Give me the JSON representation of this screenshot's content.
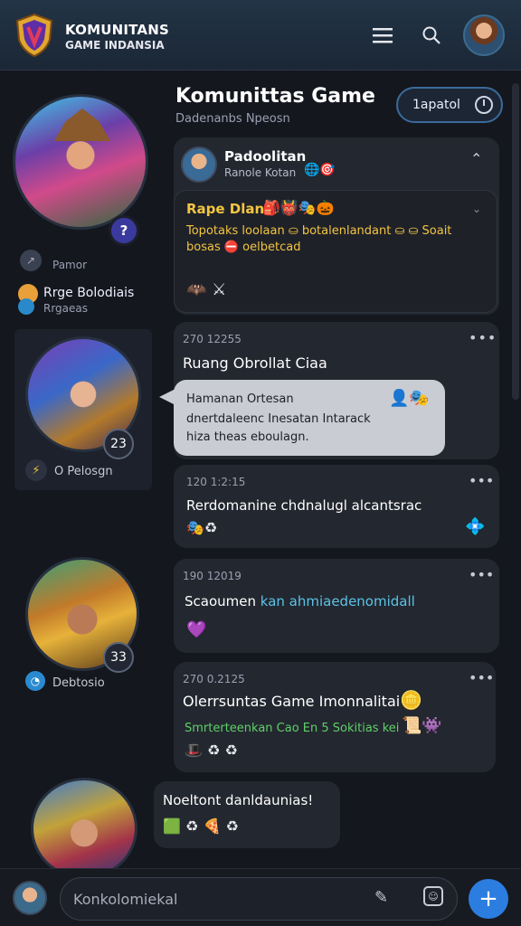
{
  "header": {
    "brand_line1": "KOMUNITANS",
    "brand_line2": "GAME INDANSIA"
  },
  "left": {
    "profile1": {
      "badge": "?",
      "meta": "Pamor",
      "name": "Rrge Bolodiais",
      "status": "Rrgaeas"
    },
    "profile2": {
      "badge": "23",
      "label": "O Pelosgn"
    },
    "profile3": {
      "badge": "33",
      "label": "Debtosio"
    }
  },
  "main": {
    "title": "Komunittas Game",
    "subtitle": "Dadenanbs Npeosn",
    "filter_label": "1apatol",
    "top_card": {
      "name": "Padoolitan",
      "sub": "Ranole Kotan",
      "label": "Rape Dlan",
      "text1": "Topotaks loolaan ⛀ botalenlandant ⛀ ⛀ Soait",
      "text2": "bosas ⛔ oelbetcad"
    },
    "posts": [
      {
        "time": "270 12255",
        "title": "Ruang Obrollat Ciaa",
        "bubble1": "Hamanan Ortesan",
        "bubble2": "dnertdaleenc Inesatan Intarack",
        "bubble3": "hiza  theas eboulagn."
      },
      {
        "time": "120 1:2:15",
        "title": "Rerdomanine chdnalugl alcantsrac"
      },
      {
        "time": "190 12019",
        "title_a": "Scaoumen ",
        "title_b": "kan ahmiaedenomidall"
      },
      {
        "time": "270 0.2125",
        "title": "Olerrsuntas Game Imonnalitai",
        "sub": "Smrterteenkan Cao En 5 Sokitias kei"
      },
      {
        "title": "Noeltont danldaunias!"
      }
    ]
  },
  "composer": {
    "placeholder": "Konkolomiekal"
  },
  "colors": {
    "accent": "#2b7de0",
    "highlight": "#f4c542",
    "link": "#5cc3e8",
    "success": "#5fd06a"
  },
  "icons": [
    "shield-logo-icon",
    "menu-icon",
    "search-icon",
    "chevron-up-icon",
    "chevron-down-icon",
    "more-icon",
    "attach-icon",
    "sticker-icon",
    "plus-icon"
  ]
}
